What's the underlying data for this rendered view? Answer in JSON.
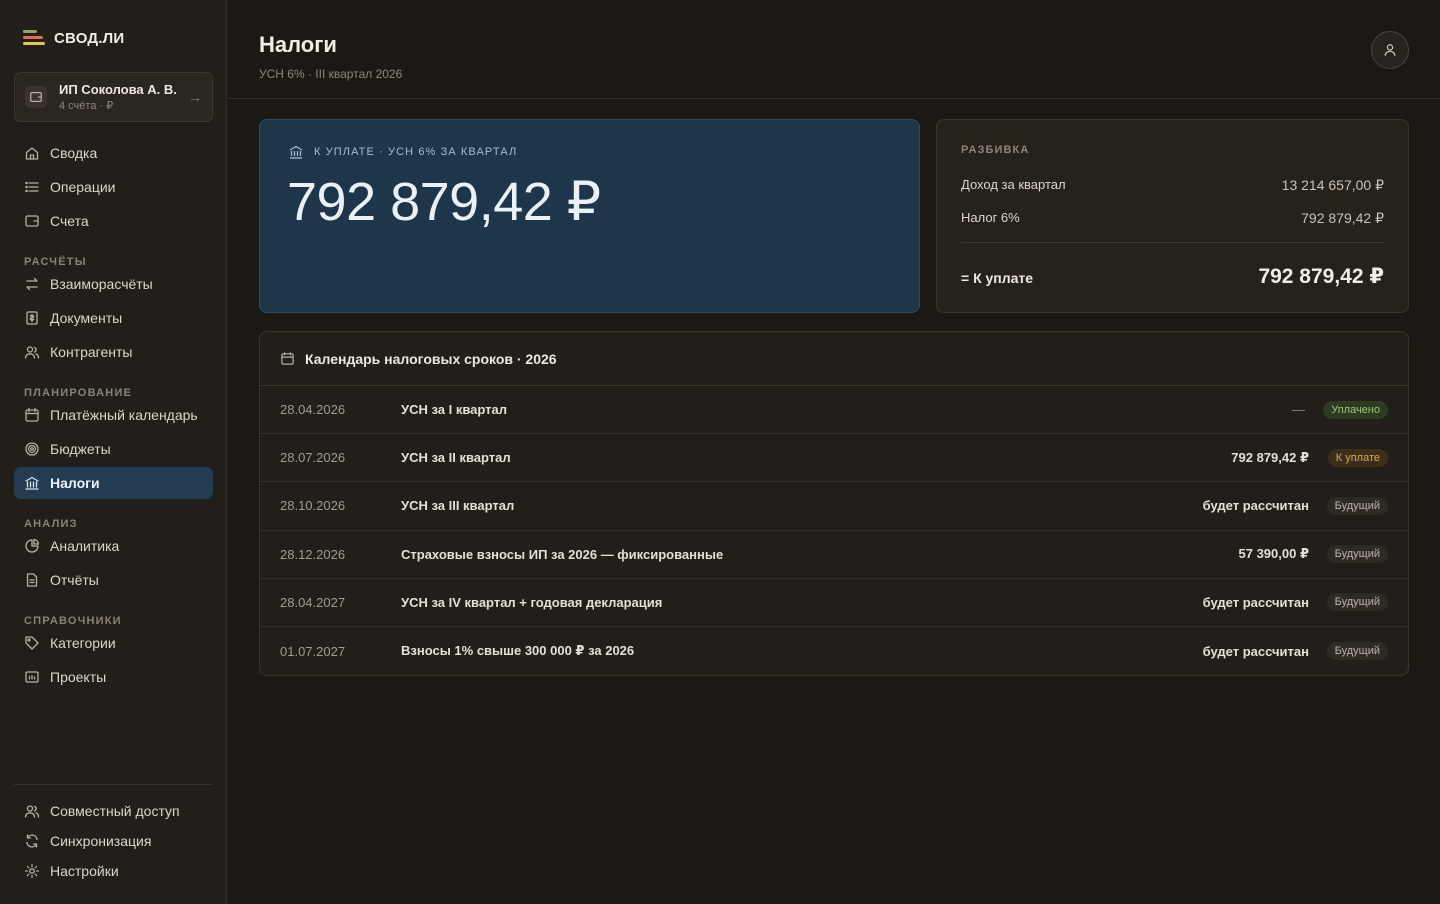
{
  "app": {
    "name": "СВОД.ЛИ"
  },
  "account": {
    "name": "ИП Соколова А. В.",
    "sub": "4 счёта · ₽"
  },
  "nav": {
    "top": [
      {
        "label": "Сводка",
        "icon": "home-icon"
      },
      {
        "label": "Операции",
        "icon": "list-icon"
      },
      {
        "label": "Счета",
        "icon": "wallet-icon"
      }
    ],
    "sections": [
      {
        "title": "РАСЧЁТЫ",
        "items": [
          {
            "label": "Взаиморасчёты",
            "icon": "swap-icon"
          },
          {
            "label": "Документы",
            "icon": "document-icon"
          },
          {
            "label": "Контрагенты",
            "icon": "users-icon"
          }
        ]
      },
      {
        "title": "ПЛАНИРОВАНИЕ",
        "items": [
          {
            "label": "Платёжный календарь",
            "icon": "calendar-icon"
          },
          {
            "label": "Бюджеты",
            "icon": "target-icon"
          },
          {
            "label": "Налоги",
            "icon": "bank-icon"
          }
        ]
      },
      {
        "title": "АНАЛИЗ",
        "items": [
          {
            "label": "Аналитика",
            "icon": "pie-icon"
          },
          {
            "label": "Отчёты",
            "icon": "report-icon"
          }
        ]
      },
      {
        "title": "СПРАВОЧНИКИ",
        "items": [
          {
            "label": "Категории",
            "icon": "tag-icon"
          },
          {
            "label": "Проекты",
            "icon": "folder-icon"
          }
        ]
      }
    ],
    "bottom": [
      {
        "label": "Совместный доступ",
        "icon": "users-icon"
      },
      {
        "label": "Синхронизация",
        "icon": "sync-icon"
      },
      {
        "label": "Настройки",
        "icon": "gear-icon"
      }
    ],
    "active": "Налоги"
  },
  "header": {
    "title": "Налоги",
    "subtitle": "УСН 6% · III квартал 2026"
  },
  "pay": {
    "label": "К УПЛАТЕ · УСН 6% ЗА КВАРТАЛ",
    "amount": "792 879,42 ₽"
  },
  "breakdown": {
    "title": "РАЗБИВКА",
    "rows": [
      {
        "label": "Доход за квартал",
        "value": "13 214 657,00 ₽"
      },
      {
        "label": "Налог 6%",
        "value": "792 879,42 ₽"
      }
    ],
    "total_label": "= К уплате",
    "total_value": "792 879,42 ₽"
  },
  "calendar": {
    "title": "Календарь налоговых сроков · 2026",
    "rows": [
      {
        "date": "28.04.2026",
        "name": "УСН за I квартал",
        "amount": "—",
        "status": "Уплачено",
        "kind": "paid"
      },
      {
        "date": "28.07.2026",
        "name": "УСН за II квартал",
        "amount": "792 879,42 ₽",
        "status": "К уплате",
        "kind": "due"
      },
      {
        "date": "28.10.2026",
        "name": "УСН за III квартал",
        "amount": "будет рассчитан",
        "status": "Будущий",
        "kind": "future"
      },
      {
        "date": "28.12.2026",
        "name": "Страховые взносы ИП за 2026 — фиксированные",
        "amount": "57 390,00 ₽",
        "status": "Будущий",
        "kind": "future"
      },
      {
        "date": "28.04.2027",
        "name": "УСН за IV квартал + годовая декларация",
        "amount": "будет рассчитан",
        "status": "Будущий",
        "kind": "future"
      },
      {
        "date": "01.07.2027",
        "name": "Взносы 1% свыше 300 000 ₽ за 2026",
        "amount": "будет рассчитан",
        "status": "Будущий",
        "kind": "future"
      }
    ]
  },
  "colors": {
    "accent": "#233c52",
    "paid": "#9cc67a",
    "due": "#e0a34b"
  }
}
